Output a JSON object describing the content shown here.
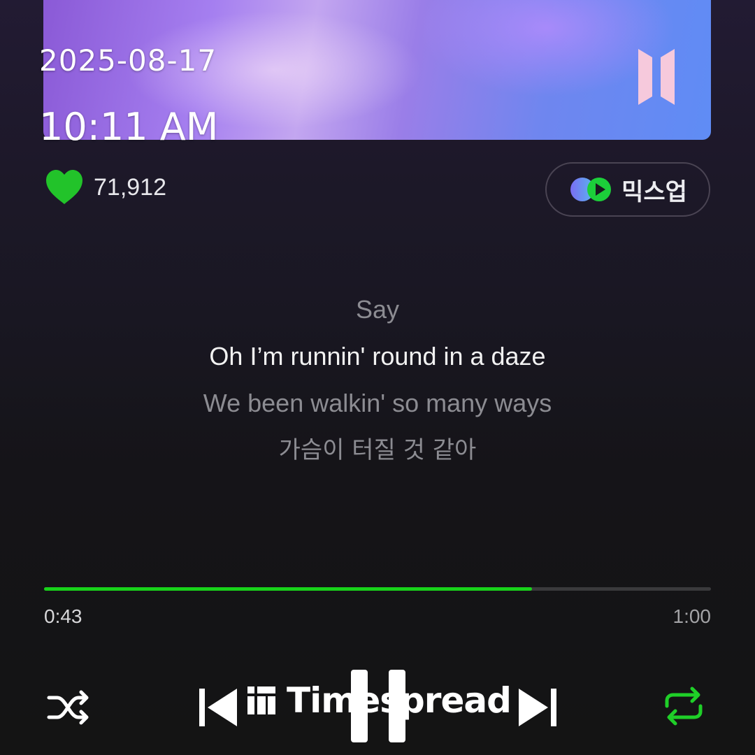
{
  "overlay": {
    "date": "2025-08-17",
    "time": "10:11 AM"
  },
  "album": {
    "logo_icon": "bts-logo-icon"
  },
  "likes": {
    "icon": "heart-icon",
    "count": "71,912",
    "color": "#22c32a"
  },
  "mixup": {
    "label": "믹스업",
    "icon": "mixup-icon"
  },
  "lyrics": [
    {
      "text": "Say",
      "current": false
    },
    {
      "text": "Oh I’m runnin' round in a daze",
      "current": true
    },
    {
      "text": "We been walkin' so many ways",
      "current": false
    },
    {
      "text": "가슴이 터질 것 같아",
      "current": false
    }
  ],
  "playback": {
    "current_time": "0:43",
    "total_time": "1:00",
    "progress_fraction": 0.7317,
    "accent_color": "#18d21a"
  },
  "controls": {
    "shuffle_icon": "shuffle-icon",
    "prev_icon": "skip-previous-icon",
    "pause_icon": "pause-icon",
    "next_icon": "skip-next-icon",
    "repeat_icon": "repeat-icon"
  },
  "watermark": {
    "text": "Timespread",
    "icon": "timespread-logo-icon"
  }
}
